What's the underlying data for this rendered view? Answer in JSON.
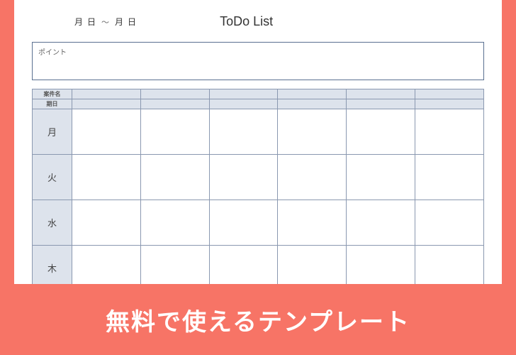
{
  "date_range": {
    "month1": "月",
    "day1": "日",
    "tilde": "～",
    "month2": "月",
    "day2": "日"
  },
  "title": "ToDo List",
  "point_label": "ポイント",
  "table": {
    "header": {
      "name": "案件名",
      "deadline": "期日"
    },
    "columns": [
      "",
      "",
      "",
      "",
      "",
      ""
    ],
    "days": [
      "月",
      "火",
      "水",
      "木"
    ]
  },
  "banner": "無料で使えるテンプレート"
}
